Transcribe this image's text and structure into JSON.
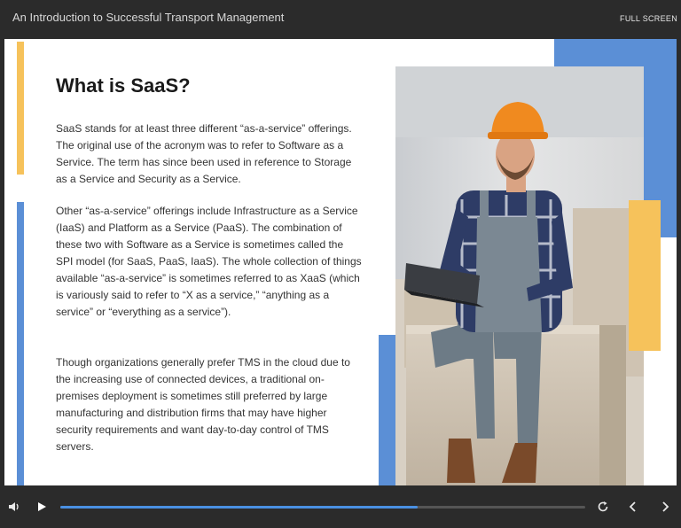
{
  "header": {
    "course_title": "An Introduction to Successful Transport Management",
    "fullscreen_label": "FULL SCREEN"
  },
  "slide": {
    "heading": "What is SaaS?",
    "paragraphs": [
      "SaaS stands for at least three different “as-a-service” offerings. The original use of the acronym was to refer to Software as a Service. The term has since been used in reference to Storage as a Service and Security as a Service.",
      "Other “as-a-service” offerings include Infrastructure as a Service (IaaS) and Platform as a Service (PaaS). The combination of these two with Software as a Service is sometimes called the SPI model (for SaaS, PaaS, IaaS). The whole collection of things available “as-a-service” is sometimes referred to as XaaS (which is variously said to refer to “X as a service,” “anything as a service” or “everything as a service”).",
      "Though organizations generally prefer TMS in the cloud due to the increasing use of connected devices, a traditional on-premises deployment is sometimes still preferred by large manufacturing and distribution firms that may have higher security requirements and want day-to-day control of TMS servers."
    ],
    "colors": {
      "accent_yellow": "#f6c25b",
      "accent_blue": "#5b8fd6"
    }
  },
  "player": {
    "progress": 0.68,
    "progress_color": "#4a90e2",
    "icons": [
      "volume-icon",
      "play-icon",
      "replay-icon",
      "previous-icon",
      "next-icon"
    ]
  }
}
